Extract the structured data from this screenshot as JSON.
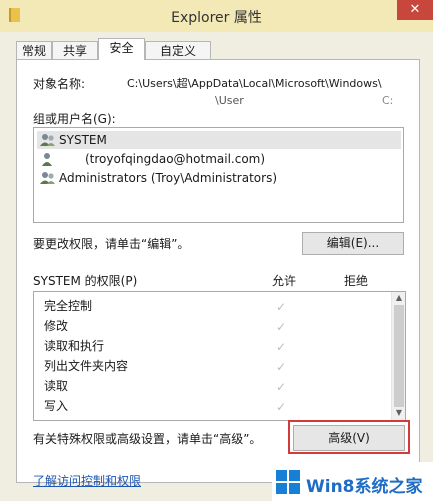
{
  "window": {
    "title": "Explorer 属性",
    "close_symbol": "✕",
    "icon": "folder-icon"
  },
  "tabs": [
    {
      "label": "常规"
    },
    {
      "label": "共享"
    },
    {
      "label": "安全"
    },
    {
      "label": "自定义"
    }
  ],
  "object_name": {
    "label": "对象名称:",
    "value_line1": "C:\\Users\\超\\AppData\\Local\\Microsoft\\Windows\\",
    "value_line2": "\\User",
    "value_line2_tail": "C:"
  },
  "groups": {
    "label": "组或用户名(G):",
    "items": [
      {
        "name": "SYSTEM",
        "icon": "users-group-icon",
        "selected": true
      },
      {
        "name": "(troyofqingdao@hotmail.com)",
        "icon": "user-icon",
        "selected": false
      },
      {
        "name": "Administrators (Troy\\Administrators)",
        "icon": "users-group-icon",
        "selected": false
      }
    ]
  },
  "edit": {
    "hint": "要更改权限，请单击“编辑”。",
    "button_label": "编辑(E)..."
  },
  "permissions": {
    "label": "SYSTEM 的权限(P)",
    "allow_header": "允许",
    "deny_header": "拒绝",
    "check_symbol": "✓",
    "rows": [
      {
        "name": "完全控制",
        "allow": true
      },
      {
        "name": "修改",
        "allow": true
      },
      {
        "name": "读取和执行",
        "allow": true
      },
      {
        "name": "列出文件夹内容",
        "allow": true
      },
      {
        "name": "读取",
        "allow": true
      },
      {
        "name": "写入",
        "allow": true
      }
    ]
  },
  "advanced": {
    "hint": "有关特殊权限或高级设置，请单击“高级”。",
    "button_label": "高级(V)"
  },
  "link": {
    "label": "了解访问控制和权限"
  },
  "watermark": {
    "text": "Win8系统之家"
  },
  "colors": {
    "title_bar": "#f2e9b6",
    "close_button": "#c7473c",
    "highlight_border": "#d33a3a",
    "link": "#1a55b4"
  }
}
